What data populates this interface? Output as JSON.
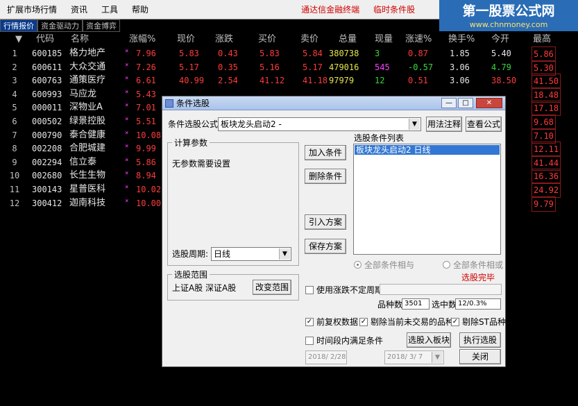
{
  "menubar": {
    "items": [
      "扩展市场行情",
      "资讯",
      "工具",
      "帮助"
    ],
    "links": [
      "通达信金融终端",
      "临时条件股"
    ]
  },
  "logo": {
    "title": "第一股票公式网",
    "url": "www.chnmoney.com"
  },
  "tabs": [
    "行情报价",
    "资金驱动力",
    "资金博弈"
  ],
  "table": {
    "headers": [
      "代码",
      "名称",
      "涨幅%",
      "现价",
      "涨跌",
      "买价",
      "卖价",
      "总量",
      "现量",
      "涨速%",
      "换手%",
      "今开",
      "最高"
    ],
    "rows": [
      {
        "n": "1",
        "code": "600185",
        "name": "格力地产",
        "pct": "7.96",
        "price": "5.83",
        "chg": "0.43",
        "bid": "5.83",
        "ask": "5.84",
        "vol": "380738",
        "cur": "3",
        "speed": "0.87",
        "turn": "1.85",
        "open": "5.40",
        "high": "5.86"
      },
      {
        "n": "2",
        "code": "600611",
        "name": "大众交通",
        "pct": "7.26",
        "price": "5.17",
        "chg": "0.35",
        "bid": "5.16",
        "ask": "5.17",
        "vol": "479016",
        "cur": "545",
        "speed": "-0.57",
        "turn": "3.06",
        "open": "4.79",
        "high": "5.30"
      },
      {
        "n": "3",
        "code": "600763",
        "name": "通策医疗",
        "pct": "6.61",
        "price": "40.99",
        "chg": "2.54",
        "bid": "41.12",
        "ask": "41.18",
        "vol": "97979",
        "cur": "12",
        "speed": "0.51",
        "turn": "3.06",
        "open": "38.50",
        "high": "41.50"
      },
      {
        "n": "4",
        "code": "600993",
        "name": "马应龙",
        "pct": "5.43",
        "price": "",
        "chg": "",
        "bid": "",
        "ask": "",
        "vol": "",
        "cur": "",
        "speed": "",
        "turn": "",
        "open": "",
        "high": "18.48"
      },
      {
        "n": "5",
        "code": "000011",
        "name": "深物业A",
        "pct": "7.01",
        "high": "17.18"
      },
      {
        "n": "6",
        "code": "000502",
        "name": "绿景控股",
        "pct": "5.51",
        "high": "9.68"
      },
      {
        "n": "7",
        "code": "000790",
        "name": "泰合健康",
        "pct": "10.08",
        "high": "7.10"
      },
      {
        "n": "8",
        "code": "002208",
        "name": "合肥城建",
        "pct": "9.99",
        "high": "12.11"
      },
      {
        "n": "9",
        "code": "002294",
        "name": "信立泰",
        "pct": "5.86",
        "high": "41.44"
      },
      {
        "n": "10",
        "code": "002680",
        "name": "长生生物",
        "pct": "8.94",
        "high": "16.36"
      },
      {
        "n": "11",
        "code": "300143",
        "name": "星普医科",
        "pct": "10.02",
        "high": "24.92"
      },
      {
        "n": "12",
        "code": "300412",
        "name": "迦南科技",
        "pct": "10.00",
        "high": "9.79"
      }
    ]
  },
  "dialog": {
    "title": "条件选股",
    "formula_label": "条件选股公式",
    "formula_value": "板块龙头启动2 -",
    "usage_btn": "用法注释",
    "view_btn": "查看公式",
    "params_group": "计算参数",
    "params_text": "无参数需要设置",
    "period_label": "选股周期:",
    "period_value": "日线",
    "add_btn": "加入条件",
    "del_btn": "删除条件",
    "import_btn": "引入方案",
    "save_btn": "保存方案",
    "cond_list_label": "选股条件列表",
    "cond_item": "板块龙头启动2   日线",
    "radio_and": "全部条件相与",
    "radio_or": "全部条件相或",
    "status": "选股完毕",
    "scope_group": "选股范围",
    "scope_text": "上证A股  深证A股",
    "scope_btn": "改变范围",
    "uncertain_period": "使用涨跌不定周期",
    "count_label": "品种数",
    "count_value": "3501",
    "selected_label": "选中数",
    "selected_value": "12/0.3%",
    "pre_adjust": "前复权数据",
    "exclude_halted": "剔除当前未交易的品种",
    "exclude_st": "剔除ST品种",
    "time_range": "时间段内满足条件",
    "to_board_btn": "选股入板块",
    "run_btn": "执行选股",
    "date_from": "2018/ 2/28",
    "date_to": "2018/ 3/ 7",
    "close_btn": "关闭"
  }
}
